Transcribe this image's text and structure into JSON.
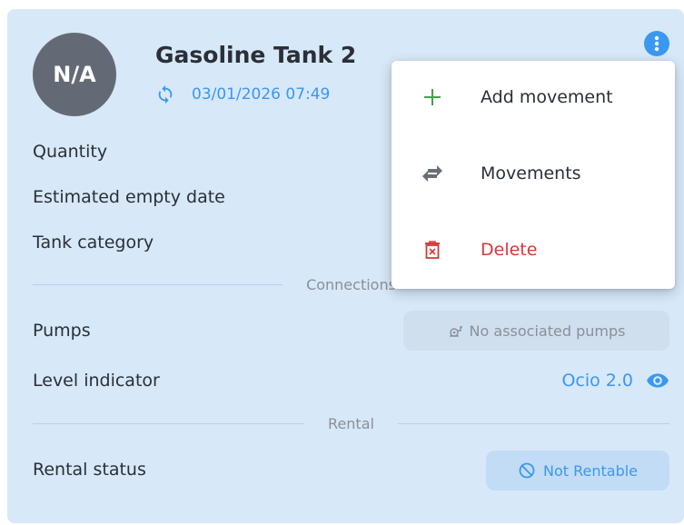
{
  "tank": {
    "avatar_text": "N/A",
    "name": "Gasoline Tank 2",
    "sync_datetime": "03/01/2026 07:49"
  },
  "rows": {
    "quantity_label": "Quantity",
    "estimated_empty_label": "Estimated empty date",
    "tank_category_label": "Tank category",
    "pumps_label": "Pumps",
    "level_indicator_label": "Level indicator",
    "rental_status_label": "Rental status"
  },
  "sections": {
    "connections": "Connections",
    "rental": "Rental"
  },
  "pumps": {
    "empty_text": "No associated pumps"
  },
  "level_indicator": {
    "value": "Ocio 2.0"
  },
  "rental": {
    "status": "Not Rentable"
  },
  "menu": {
    "items": [
      {
        "label": "Add movement",
        "icon": "plus-icon"
      },
      {
        "label": "Movements",
        "icon": "swap-arrows-icon"
      },
      {
        "label": "Delete",
        "icon": "trash-icon"
      }
    ]
  },
  "colors": {
    "card_bg": "#d7e8f8",
    "accent": "#3b98f0",
    "danger": "#d23a3a",
    "add_green": "#43a047"
  }
}
